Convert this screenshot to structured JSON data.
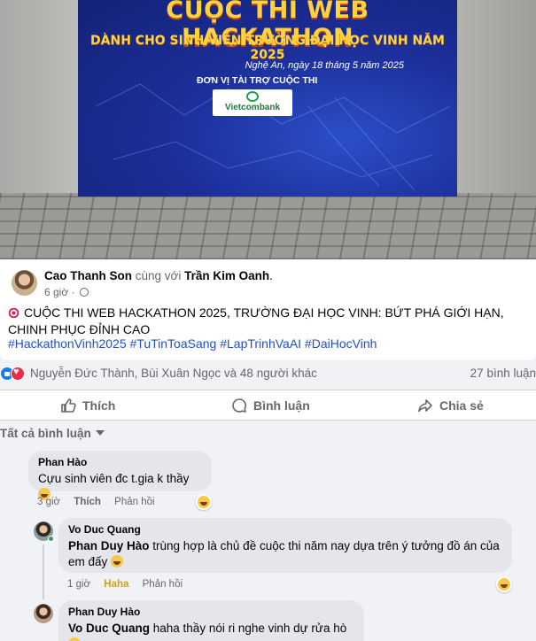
{
  "photo": {
    "banner_title": "CUỘC THI WEB HACKATHON",
    "banner_subtitle": "DÀNH CHO SINH VIÊN TRƯỜNG ĐẠI HỌC VINH NĂM 2025",
    "banner_date": "Nghệ An, ngày 18 tháng 5 năm 2025",
    "banner_sponsor": "ĐƠN VỊ TÀI TRỢ CUỘC THI",
    "banner_logo": "Vietcombank"
  },
  "post": {
    "author": "Cao Thanh Son",
    "with_text": " cùng với ",
    "tagged": "Trần Kim Oanh",
    "trailing": ".",
    "time": "6 giờ",
    "separator": " · ",
    "text": "CUỘC THI WEB HACKATHON 2025, TRƯỜNG ĐẠI HỌC VINH: BỨT PHÁ GIỚI HẠN, CHINH PHỤC ĐỈNH CAO",
    "hashtags": "#HackathonVinh2025 #TuTinToaSang #LapTrinhVaAI #DaiHocVinh"
  },
  "reactions": {
    "names": "Nguyễn Đức Thành, Bùi Xuân Ngọc và 48 người khác",
    "comment_count": "27 bình luận"
  },
  "actions": {
    "like": "Thích",
    "comment": "Bình luận",
    "share": "Chia sẻ"
  },
  "filter": {
    "label": "Tất cả bình luận"
  },
  "comments": [
    {
      "name": "Phan Hào",
      "text": "Cựu sinh viên đc t.gia k thầy",
      "time": "3 giờ",
      "like": "Thích",
      "reply": "Phản hồi"
    },
    {
      "name": "Vo Duc Quang",
      "mention": "Phan Duy Hào",
      "text": " trùng hợp là chủ đề cuộc thi năm nay dựa trên ý tưởng đồ án của em đấy",
      "time": "1 giờ",
      "reaction": "Haha",
      "reply": "Phản hồi"
    },
    {
      "name": "Phan Duy Hào",
      "mention": "Vo Duc Quang",
      "text": " haha thầy nói ri nghe vinh dự rửa hò"
    }
  ],
  "colors": {
    "link_blue": "#1d4ed8",
    "like_blue": "#1877f2",
    "love_red": "#f02849",
    "banner_yellow": "#ffd23f",
    "bubble_gray": "#e4e6eb"
  }
}
